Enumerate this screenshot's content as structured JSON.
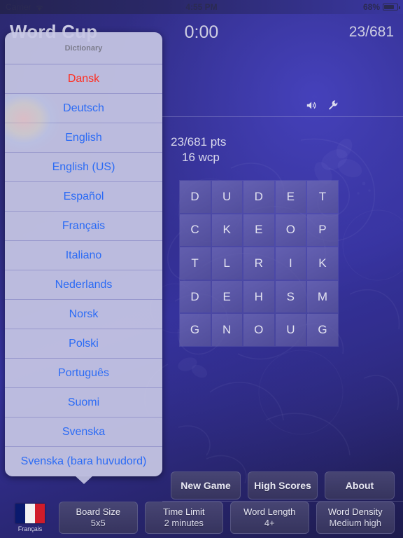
{
  "status_bar": {
    "carrier": "Carrier",
    "wifi_icon": "wifi-icon",
    "time": "4:55 PM",
    "battery_percent": "68%",
    "battery_icon": "battery-icon"
  },
  "header": {
    "app_title": "Word Cup",
    "timer": "0:00",
    "score": "23/681"
  },
  "game": {
    "sound_icon": "speaker-icon",
    "settings_icon": "wrench-icon",
    "points_line1": "23/681 pts",
    "points_line2": "16 wcp",
    "grid_rows": [
      [
        "D",
        "U",
        "D",
        "E",
        "T"
      ],
      [
        "C",
        "K",
        "E",
        "O",
        "P"
      ],
      [
        "T",
        "L",
        "R",
        "I",
        "K"
      ],
      [
        "D",
        "E",
        "H",
        "S",
        "M"
      ],
      [
        "G",
        "N",
        "O",
        "U",
        "G"
      ]
    ]
  },
  "toolbar_top": [
    {
      "label": "New Game"
    },
    {
      "label": "High Scores"
    },
    {
      "label": "About"
    }
  ],
  "toolbar_bottom": {
    "flag": {
      "icon": "france-flag-icon",
      "label": "Français"
    },
    "options": [
      {
        "title": "Board Size",
        "value": "5x5"
      },
      {
        "title": "Time Limit",
        "value": "2 minutes"
      },
      {
        "title": "Word Length",
        "value": "4+"
      },
      {
        "title": "Word Density",
        "value": "Medium high"
      }
    ]
  },
  "popover": {
    "title": "Dictionary",
    "items": [
      {
        "label": "Dansk",
        "style": "destructive"
      },
      {
        "label": "Deutsch",
        "style": "normal"
      },
      {
        "label": "English",
        "style": "normal"
      },
      {
        "label": "English (US)",
        "style": "normal"
      },
      {
        "label": "Español",
        "style": "normal"
      },
      {
        "label": "Français",
        "style": "normal"
      },
      {
        "label": "Italiano",
        "style": "normal"
      },
      {
        "label": "Nederlands",
        "style": "normal"
      },
      {
        "label": "Norsk",
        "style": "normal"
      },
      {
        "label": "Polski",
        "style": "normal"
      },
      {
        "label": "Português",
        "style": "normal"
      },
      {
        "label": "Suomi",
        "style": "normal"
      },
      {
        "label": "Svenska",
        "style": "normal"
      },
      {
        "label": "Svenska (bara huvudord)",
        "style": "normal"
      }
    ]
  },
  "colors": {
    "accent_blue": "#2b6bf5",
    "destructive_red": "#ff2f22",
    "background_deep": "#2a2768",
    "tile": "#6c68b4"
  }
}
